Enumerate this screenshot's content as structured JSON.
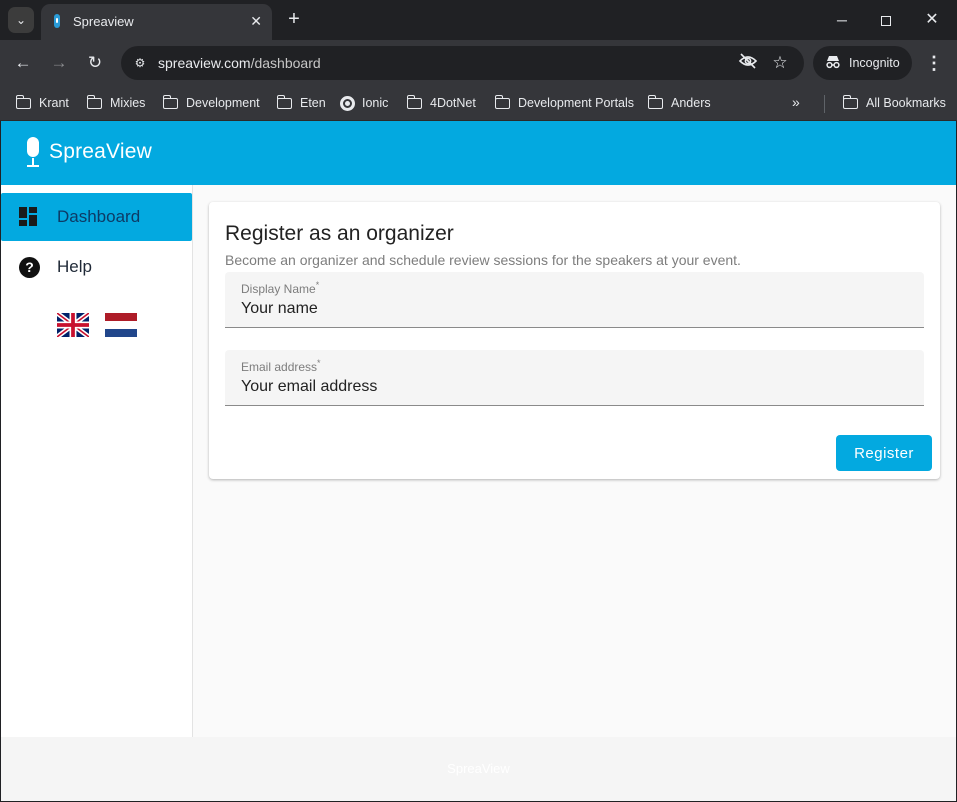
{
  "browser": {
    "tab_title": "Spreaview",
    "url_domain": "spreaview.com",
    "url_path": "/dashboard",
    "profile_label": "Incognito",
    "bookmarks": [
      "Krant",
      "Mixies",
      "Development",
      "Eten",
      "Ionic",
      "4DotNet",
      "Development Portals",
      "Anders"
    ],
    "all_bookmarks_label": "All Bookmarks"
  },
  "app": {
    "logo_text": "SpreaView",
    "brand_color": "#03a9e0",
    "nav": [
      {
        "label": "Dashboard",
        "icon": "dashboard-icon",
        "active": true
      },
      {
        "label": "Help",
        "icon": "help-icon",
        "active": false
      }
    ],
    "languages": [
      "uk-flag",
      "nl-flag"
    ],
    "footer_text": "SpreaView"
  },
  "register_card": {
    "title": "Register as an organizer",
    "subtitle": "Become an organizer and schedule review sessions for the speakers at your event.",
    "display_name": {
      "label": "Display Name",
      "required_mark": "*",
      "placeholder": "Your name",
      "value": ""
    },
    "email": {
      "label": "Email address",
      "required_mark": "*",
      "placeholder": "Your email address",
      "value": ""
    },
    "submit_label": "Register"
  }
}
